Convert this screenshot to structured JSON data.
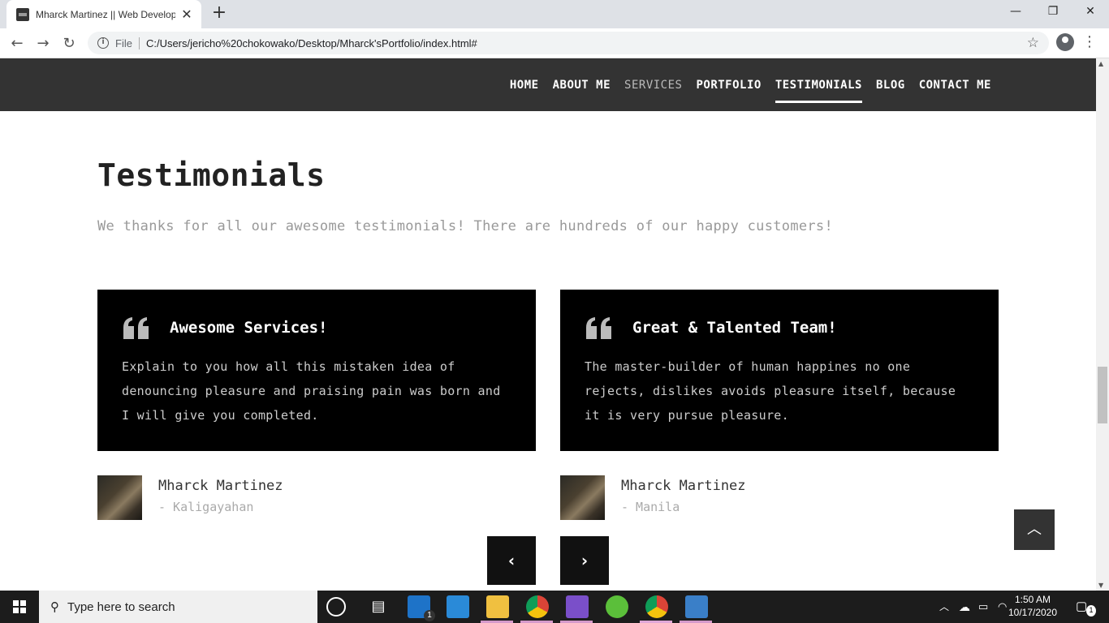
{
  "browser": {
    "tab_title": "Mharck Martinez || Web Developer",
    "scheme_label": "File",
    "url": "C:/Users/jericho%20chokowako/Desktop/Mharck'sPortfolio/index.html#"
  },
  "nav": {
    "items": [
      "HOME",
      "ABOUT ME",
      "SERVICES",
      "PORTFOLIO",
      "TESTIMONIALS",
      "BLOG",
      "CONTACT ME"
    ],
    "active": "TESTIMONIALS"
  },
  "section": {
    "title": "Testimonials",
    "subtitle": "We thanks for all our awesome testimonials! There are hundreds of our happy customers!"
  },
  "testimonials": [
    {
      "title": "Awesome Services!",
      "text": "Explain to you how all this mistaken idea of denouncing pleasure and praising pain was born and I will give you completed.",
      "author": "Mharck Martinez",
      "location": "- Kaligayahan"
    },
    {
      "title": "Great & Talented Team!",
      "text": "The master-builder of human happines no one rejects, dislikes avoids pleasure itself, because it is very pursue pleasure.",
      "author": "Mharck Martinez",
      "location": "- Manila"
    }
  ],
  "carousel": {
    "prev_icon": "chevron-left-icon",
    "next_icon": "chevron-right-icon"
  },
  "taskbar": {
    "search_placeholder": "Type here to search",
    "mail_badge": "1",
    "time": "1:50 AM",
    "date": "10/17/2020",
    "notification_count": "1"
  }
}
